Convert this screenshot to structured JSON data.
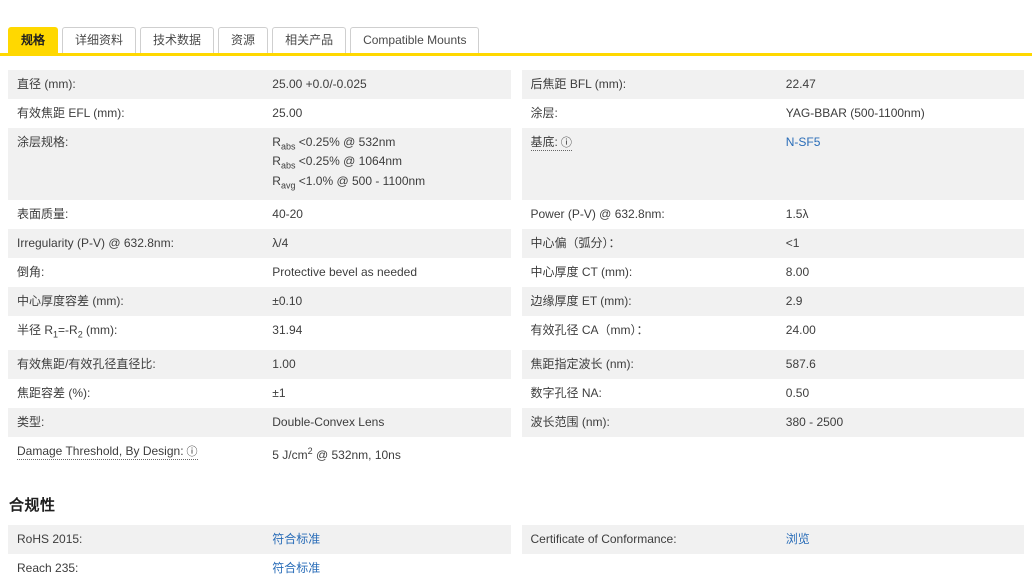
{
  "colors": {
    "accent_yellow": "#ffd800",
    "link_blue": "#2a6db8",
    "stripe_gray": "#f1f1f1"
  },
  "info_icon_glyph": "ⓘ",
  "tabs": [
    {
      "key": "specs",
      "label": "规格",
      "active": true
    },
    {
      "key": "details",
      "label": "详细资料",
      "active": false
    },
    {
      "key": "tech-data",
      "label": "技术数据",
      "active": false
    },
    {
      "key": "resources",
      "label": "资源",
      "active": false
    },
    {
      "key": "related-products",
      "label": "相关产品",
      "active": false
    },
    {
      "key": "compatible-mounts",
      "label": "Compatible Mounts",
      "active": false
    }
  ],
  "specs": {
    "rows": [
      {
        "left": {
          "label": "直径 (mm):",
          "value": "25.00 +0.0/-0.025"
        },
        "right": {
          "label": "后焦距 BFL (mm):",
          "value": "22.47"
        }
      },
      {
        "left": {
          "label": "有效焦距 EFL (mm):",
          "value": "25.00"
        },
        "right": {
          "label": "涂层:",
          "value": "YAG-BBAR (500-1100nm)"
        }
      },
      {
        "left": {
          "label": "涂层规格:",
          "value_html": "R<sub>abs</sub> &lt;0.25% @ 532nm<br>R<sub>abs</sub> &lt;0.25% @ 1064nm<br>R<sub>avg</sub> &lt;1.0% @ 500 - 1100nm"
        },
        "right": {
          "label": "基底:",
          "info": true,
          "value": "N-SF5",
          "link": true
        }
      },
      {
        "left": {
          "label": "表面质量:",
          "value": "40-20"
        },
        "right": {
          "label": "Power (P-V) @ 632.8nm:",
          "value": "1.5λ"
        }
      },
      {
        "left": {
          "label": "Irregularity (P-V) @ 632.8nm:",
          "value": "λ/4"
        },
        "right": {
          "label": "中心偏（弧分）：",
          "value_html": "&lt;1"
        }
      },
      {
        "left": {
          "label": "倒角:",
          "value": "Protective bevel as needed"
        },
        "right": {
          "label": "中心厚度 CT (mm):",
          "value": "8.00"
        }
      },
      {
        "left": {
          "label": "中心厚度容差 (mm):",
          "value": "±0.10"
        },
        "right": {
          "label": "边缘厚度 ET (mm):",
          "value": "2.9"
        }
      },
      {
        "left": {
          "label_html": "半径 R<sub>1</sub>=-R<sub>2</sub> (mm):",
          "value": "31.94"
        },
        "right": {
          "label": "有效孔径 CA（mm）：",
          "value": "24.00"
        }
      },
      {
        "left": {
          "label": "有效焦距/有效孔径直径比:",
          "value": "1.00"
        },
        "right": {
          "label": "焦距指定波长 (nm):",
          "value": "587.6"
        }
      },
      {
        "left": {
          "label": "焦距容差 (%):",
          "value": "±1"
        },
        "right": {
          "label": "数字孔径 NA:",
          "value": "0.50"
        }
      },
      {
        "left": {
          "label": "类型:",
          "value": "Double-Convex Lens"
        },
        "right": {
          "label": "波长范围 (nm):",
          "value": "380 - 2500"
        }
      },
      {
        "left": {
          "label": "Damage Threshold, By Design:",
          "info": true,
          "value_html": "5 J/cm<sup>2</sup> @ 532nm, 10ns"
        },
        "right": null
      }
    ]
  },
  "compliance": {
    "title": "合规性",
    "rows": [
      {
        "left": {
          "label": "RoHS 2015:",
          "value": "符合标准",
          "link": true
        },
        "right": {
          "label": "Certificate of Conformance:",
          "value": "浏览",
          "link": true
        }
      },
      {
        "left": {
          "label": "Reach 235:",
          "value": "符合标准",
          "link": true
        },
        "right": null
      }
    ]
  }
}
